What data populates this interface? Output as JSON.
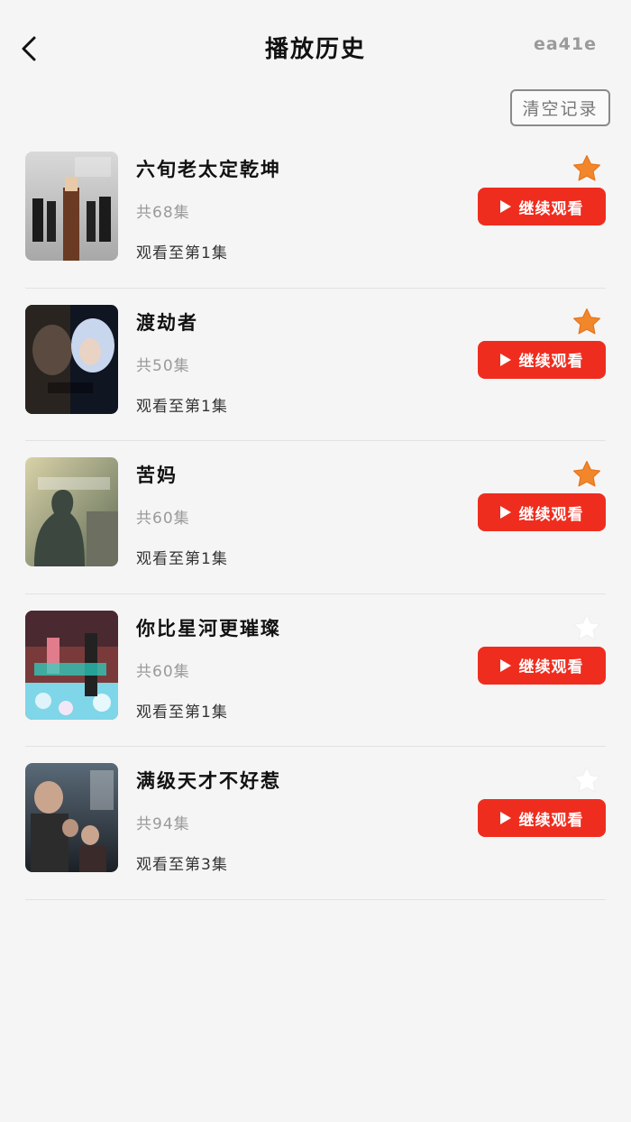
{
  "header": {
    "title": "播放历史",
    "code": "ea41e",
    "clear_label": "清空记录"
  },
  "colors": {
    "accent": "#ef2d1f",
    "star_active": "#f2862a",
    "star_inactive": "#ffffff"
  },
  "items": [
    {
      "title": "六旬老太定乾坤",
      "episodes": "共68集",
      "progress": "观看至第1集",
      "button": "继续观看",
      "favorited": true
    },
    {
      "title": "渡劫者",
      "episodes": "共50集",
      "progress": "观看至第1集",
      "button": "继续观看",
      "favorited": true
    },
    {
      "title": "苦妈",
      "episodes": "共60集",
      "progress": "观看至第1集",
      "button": "继续观看",
      "favorited": true
    },
    {
      "title": "你比星河更璀璨",
      "episodes": "共60集",
      "progress": "观看至第1集",
      "button": "继续观看",
      "favorited": false
    },
    {
      "title": "满级天才不好惹",
      "episodes": "共94集",
      "progress": "观看至第3集",
      "button": "继续观看",
      "favorited": false
    }
  ]
}
